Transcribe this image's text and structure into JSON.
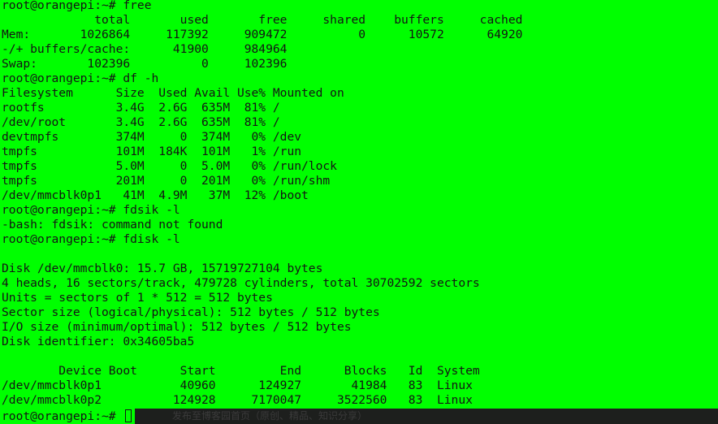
{
  "terminal": {
    "lines": [
      "root@orangepi:~# free",
      "             total       used       free     shared    buffers     cached",
      "Mem:       1026864     117392     909472          0      10572      64920",
      "-/+ buffers/cache:      41900     984964",
      "Swap:       102396          0     102396",
      "root@orangepi:~# df -h",
      "Filesystem      Size  Used Avail Use% Mounted on",
      "rootfs          3.4G  2.6G  635M  81% /",
      "/dev/root       3.4G  2.6G  635M  81% /",
      "devtmpfs        374M     0  374M   0% /dev",
      "tmpfs           101M  184K  101M   1% /run",
      "tmpfs           5.0M     0  5.0M   0% /run/lock",
      "tmpfs           201M     0  201M   0% /run/shm",
      "/dev/mmcblk0p1   41M  4.9M   37M  12% /boot",
      "root@orangepi:~# fdsik -l",
      "-bash: fdsik: command not found",
      "root@orangepi:~# fdisk -l",
      "",
      "Disk /dev/mmcblk0: 15.7 GB, 15719727104 bytes",
      "4 heads, 16 sectors/track, 479728 cylinders, total 30702592 sectors",
      "Units = sectors of 1 * 512 = 512 bytes",
      "Sector size (logical/physical): 512 bytes / 512 bytes",
      "I/O size (minimum/optimal): 512 bytes / 512 bytes",
      "Disk identifier: 0x34605ba5",
      "",
      "        Device Boot      Start         End      Blocks   Id  System",
      "/dev/mmcblk0p1           40960      124927       41984   83  Linux",
      "/dev/mmcblk0p2          124928     7170047     3522560   83  Linux"
    ],
    "active_prompt": "root@orangepi:~# ",
    "ghost_overlay_text": "发布至博客园首页（原创、精品、知识分享）",
    "colors": {
      "background": "#00ff00",
      "foreground": "#141414",
      "bottom_bar": "#1d1f1d"
    }
  }
}
